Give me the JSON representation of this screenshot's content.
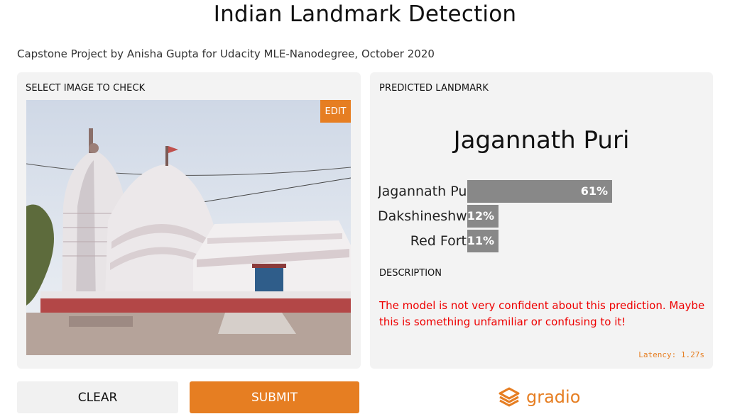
{
  "header": {
    "title": "Indian Landmark Detection",
    "subtitle": "Capstone Project by Anisha Gupta for Udacity MLE-Nanodegree, October 2020"
  },
  "input_panel": {
    "label": "SELECT IMAGE TO CHECK",
    "edit_label": "EDIT"
  },
  "output_panel": {
    "label": "PREDICTED LANDMARK",
    "prediction": "Jagannath Puri",
    "confidences": [
      {
        "label": "Jagannath Pu",
        "value_text": "61%",
        "value": 0.61
      },
      {
        "label": "Dakshineshw",
        "value_text": "12%",
        "value": 0.12
      },
      {
        "label": "Red Fort",
        "value_text": "11%",
        "value": 0.11
      }
    ],
    "description_label": "DESCRIPTION",
    "description": "The model is not very confident about this prediction. Maybe this is something unfamiliar or confusing to it!",
    "latency": "Latency: 1.27s"
  },
  "actions": {
    "clear_label": "CLEAR",
    "submit_label": "SUBMIT"
  },
  "branding": {
    "logo_text": "gradio",
    "logo_icon": "gradio-logo-icon"
  },
  "colors": {
    "accent": "#e67e22",
    "bar": "#888888",
    "warning": "#ee0000",
    "panel_bg": "#f3f3f3"
  }
}
